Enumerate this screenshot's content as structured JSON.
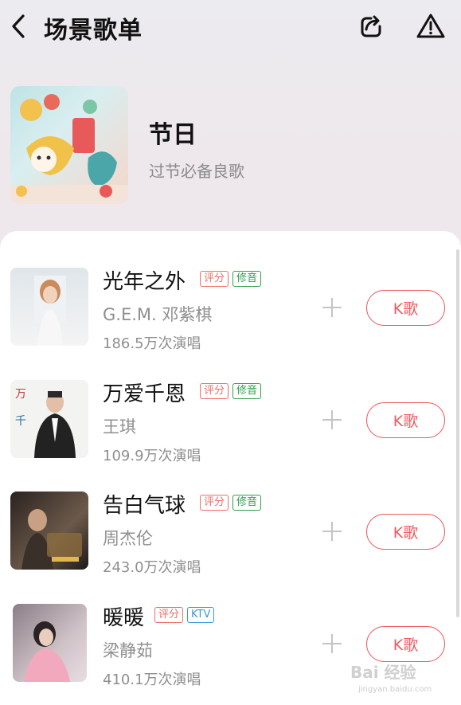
{
  "header": {
    "title": "场景歌单"
  },
  "playlist": {
    "name": "节日",
    "subtitle": "过节必备良歌"
  },
  "songs": [
    {
      "title": "光年之外",
      "tags": [
        "评分",
        "修音"
      ],
      "artist": "G.E.M. 邓紫棋",
      "plays": "186.5万次演唱",
      "k_label": "K歌"
    },
    {
      "title": "万爱千恩",
      "tags": [
        "评分",
        "修音"
      ],
      "artist": "王琪",
      "plays": "109.9万次演唱",
      "k_label": "K歌"
    },
    {
      "title": "告白气球",
      "tags": [
        "评分",
        "修音"
      ],
      "artist": "周杰伦",
      "plays": "243.0万次演唱",
      "k_label": "K歌"
    },
    {
      "title": "暖暖",
      "tags": [
        "评分",
        "KTV"
      ],
      "artist": "梁静茹",
      "plays": "410.1万次演唱",
      "k_label": "K歌"
    }
  ],
  "watermark": {
    "text": "Bai 经验",
    "url": "jingyan.baidu.com"
  },
  "colors": {
    "accent": "#ee5a62",
    "tag_score": "#ee6d67",
    "tag_fix": "#2fa04a",
    "tag_ktv": "#3a9ad9"
  }
}
